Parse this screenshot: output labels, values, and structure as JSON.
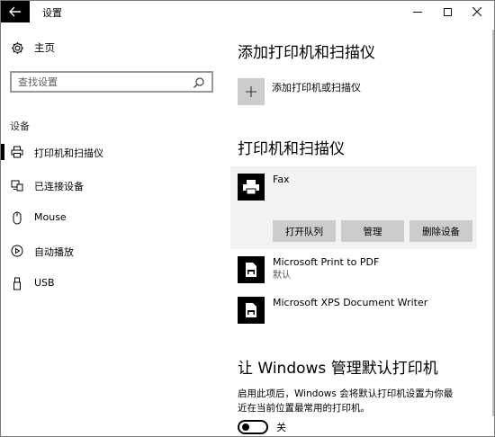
{
  "window": {
    "title": "设置"
  },
  "sidebar": {
    "home_label": "主页",
    "search_placeholder": "查找设置",
    "section_label": "设备",
    "items": [
      {
        "label": "打印机和扫描仪",
        "icon": "printer-icon",
        "active": true
      },
      {
        "label": "已连接设备",
        "icon": "connected-devices-icon",
        "active": false
      },
      {
        "label": "Mouse",
        "icon": "mouse-icon",
        "active": false
      },
      {
        "label": "自动播放",
        "icon": "autoplay-icon",
        "active": false
      },
      {
        "label": "USB",
        "icon": "usb-icon",
        "active": false
      }
    ]
  },
  "main": {
    "add_heading": "添加打印机和扫描仪",
    "add_button_label": "添加打印机或扫描仪",
    "list_heading": "打印机和扫描仪",
    "printers": [
      {
        "name": "Fax",
        "status": ""
      },
      {
        "name": "Microsoft Print to PDF",
        "status": "默认"
      },
      {
        "name": "Microsoft XPS Document Writer",
        "status": ""
      }
    ],
    "buttons": {
      "open_queue": "打开队列",
      "manage": "管理",
      "remove": "删除设备"
    },
    "default_heading": "让 Windows 管理默认打印机",
    "default_desc_line1": "启用此项后，Windows 会将默认打印机设置为你最",
    "default_desc_line2": "近在当前位置最常用的打印机。",
    "toggle_state": "关"
  },
  "colors": {
    "titlebar_back": "#000000",
    "tile_gray": "#cccccc",
    "card_bg": "#f2f2f2"
  }
}
